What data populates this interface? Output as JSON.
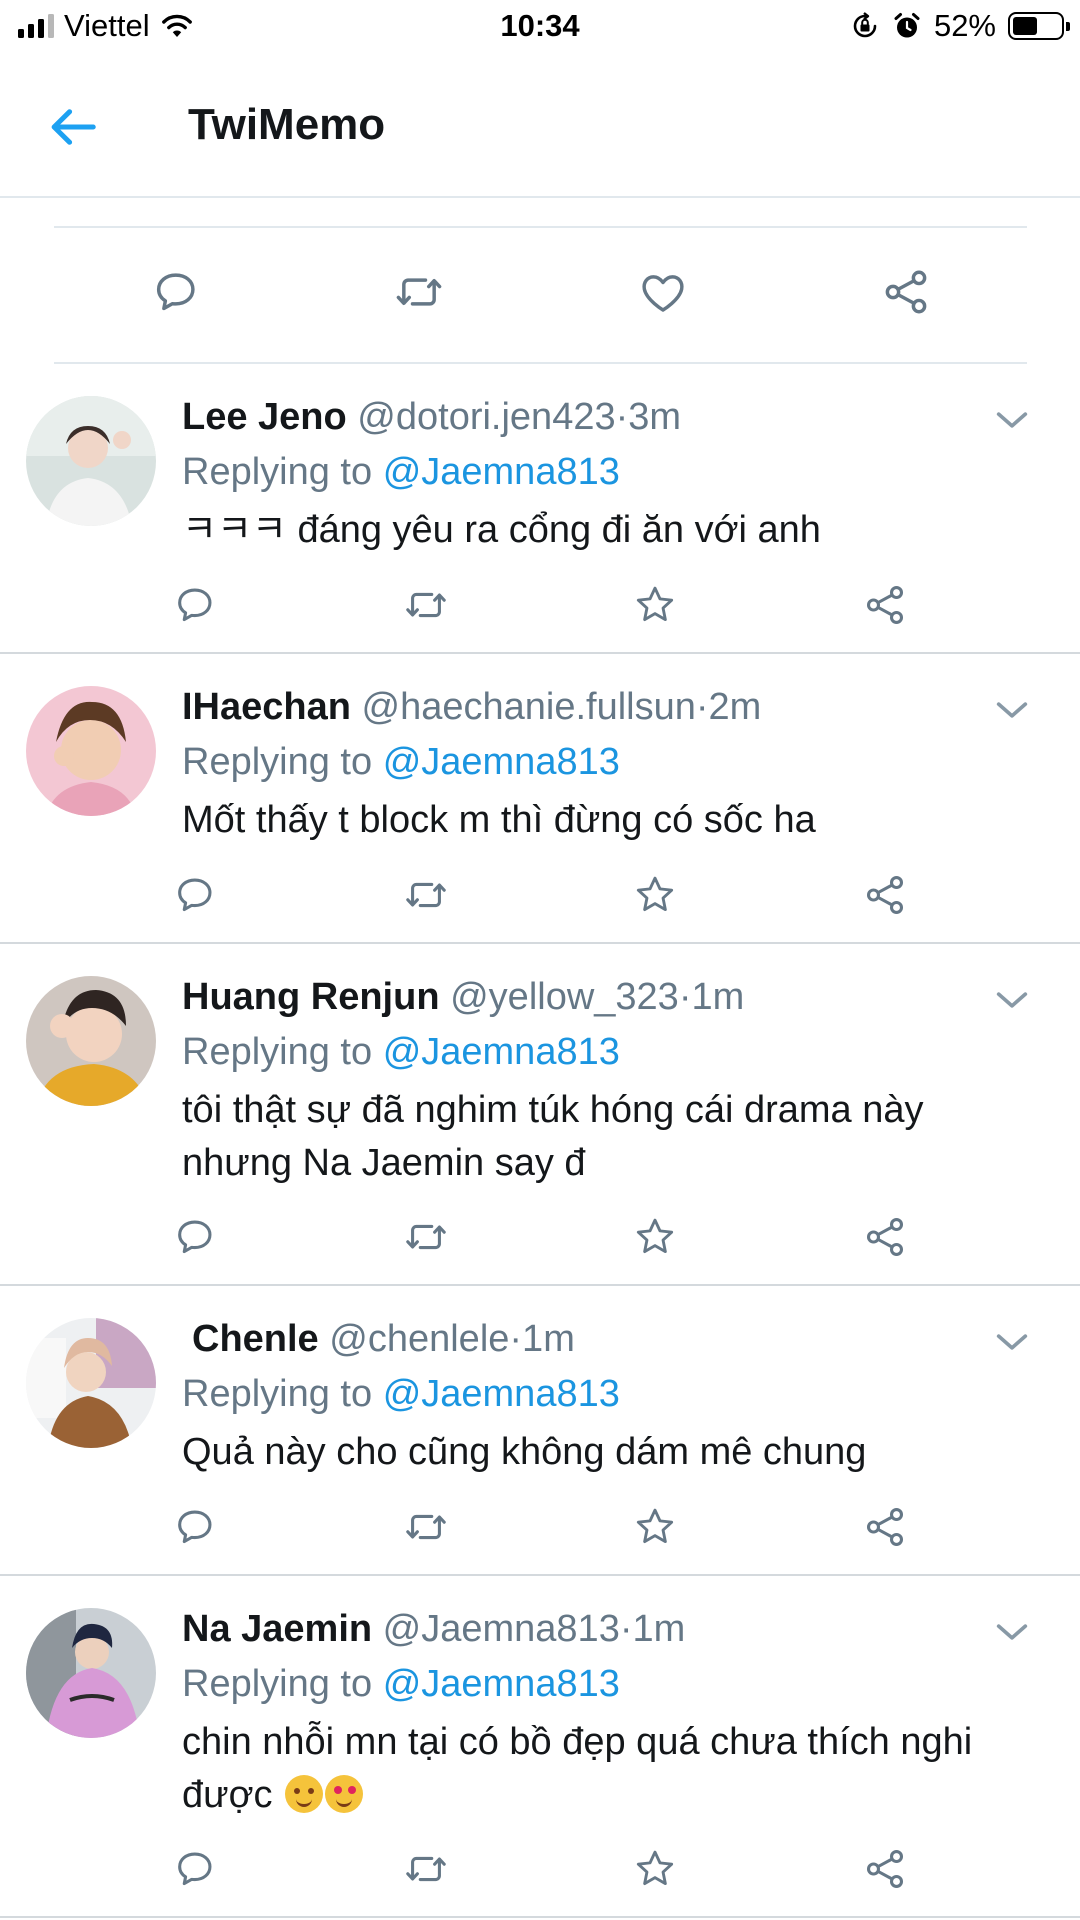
{
  "status_bar": {
    "carrier": "Viettel",
    "time": "10:34",
    "battery": "52%",
    "battery_level": 0.52
  },
  "header": {
    "title": "TwiMemo"
  },
  "icons": {
    "back": "arrow-left-icon",
    "reply": "speech-bubble-icon",
    "retweet": "retweet-icon",
    "like": "heart-icon",
    "favorite": "star-icon",
    "share": "share-icon",
    "more": "chevron-down-icon"
  },
  "colors": {
    "accent": "#1da1f2",
    "mention": "#1b95e0",
    "muted": "#657786",
    "text": "#14171a"
  },
  "tweets": [
    {
      "name": "Lee Jeno",
      "handle": "@dotori.jen423",
      "time": "·3m",
      "reply_prefix": "Replying to",
      "reply_to": "@Jaemna813",
      "text": "ㅋㅋㅋ đáng yêu ra cổng đi ăn với anh"
    },
    {
      "name": "IHaechan",
      "handle": "@haechanie.fullsun",
      "time": "·2m",
      "reply_prefix": "Replying to",
      "reply_to": "@Jaemna813",
      "text": "Mốt thấy t block m thì đừng có sốc ha"
    },
    {
      "name": "Huang Renjun",
      "handle": "@yellow_323",
      "time": "·1m",
      "reply_prefix": "Replying to",
      "reply_to": "@Jaemna813",
      "text_line1": "tôi thật sự đã nghim túk hóng cái drama này",
      "text_line2": "nhưng Na Jaemin say đ"
    },
    {
      "name": "Chenle",
      "handle": "@chenlele",
      "time": "·1m",
      "reply_prefix": "Replying to",
      "reply_to": "@Jaemna813",
      "text": "Quả này cho cũng không dám mê chung"
    },
    {
      "name": "Na Jaemin",
      "handle": "@Jaemna813",
      "time": "·1m",
      "reply_prefix": "Replying to",
      "reply_to": "@Jaemna813",
      "text_line1": "chin nhỗi mn tại có bồ đẹp quá chưa thích nghi",
      "text_line2": "được"
    }
  ]
}
